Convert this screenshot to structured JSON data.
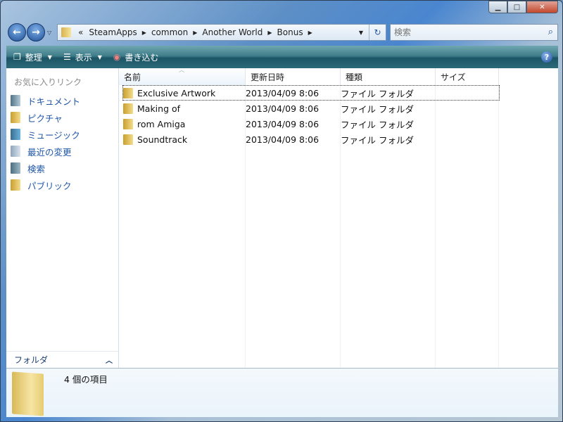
{
  "window": {
    "controls": [
      "minimize",
      "maximize",
      "close"
    ]
  },
  "nav": {
    "back_icon": "back-arrow-icon",
    "forward_icon": "forward-arrow-icon"
  },
  "address": {
    "overflow": "«",
    "crumbs": [
      "SteamApps",
      "common",
      "Another World",
      "Bonus"
    ]
  },
  "search": {
    "placeholder": "検索"
  },
  "toolbar": {
    "organize": "整理",
    "views": "表示",
    "burn": "書き込む"
  },
  "sidebar": {
    "header": "お気に入りリンク",
    "items": [
      {
        "label": "ドキュメント",
        "icon": "documents"
      },
      {
        "label": "ピクチャ",
        "icon": "folder"
      },
      {
        "label": "ミュージック",
        "icon": "music"
      },
      {
        "label": "最近の変更",
        "icon": "recent"
      },
      {
        "label": "検索",
        "icon": "search"
      },
      {
        "label": "パブリック",
        "icon": "folder"
      }
    ],
    "folders_label": "フォルダ"
  },
  "columns": [
    "名前",
    "更新日時",
    "種類",
    "サイズ"
  ],
  "files": [
    {
      "name": "Exclusive Artwork",
      "date": "2013/04/09 8:06",
      "type": "ファイル フォルダ"
    },
    {
      "name": "Making of",
      "date": "2013/04/09 8:06",
      "type": "ファイル フォルダ"
    },
    {
      "name": "rom Amiga",
      "date": "2013/04/09 8:06",
      "type": "ファイル フォルダ"
    },
    {
      "name": "Soundtrack",
      "date": "2013/04/09 8:06",
      "type": "ファイル フォルダ"
    }
  ],
  "details": {
    "count": "4 個の項目"
  }
}
